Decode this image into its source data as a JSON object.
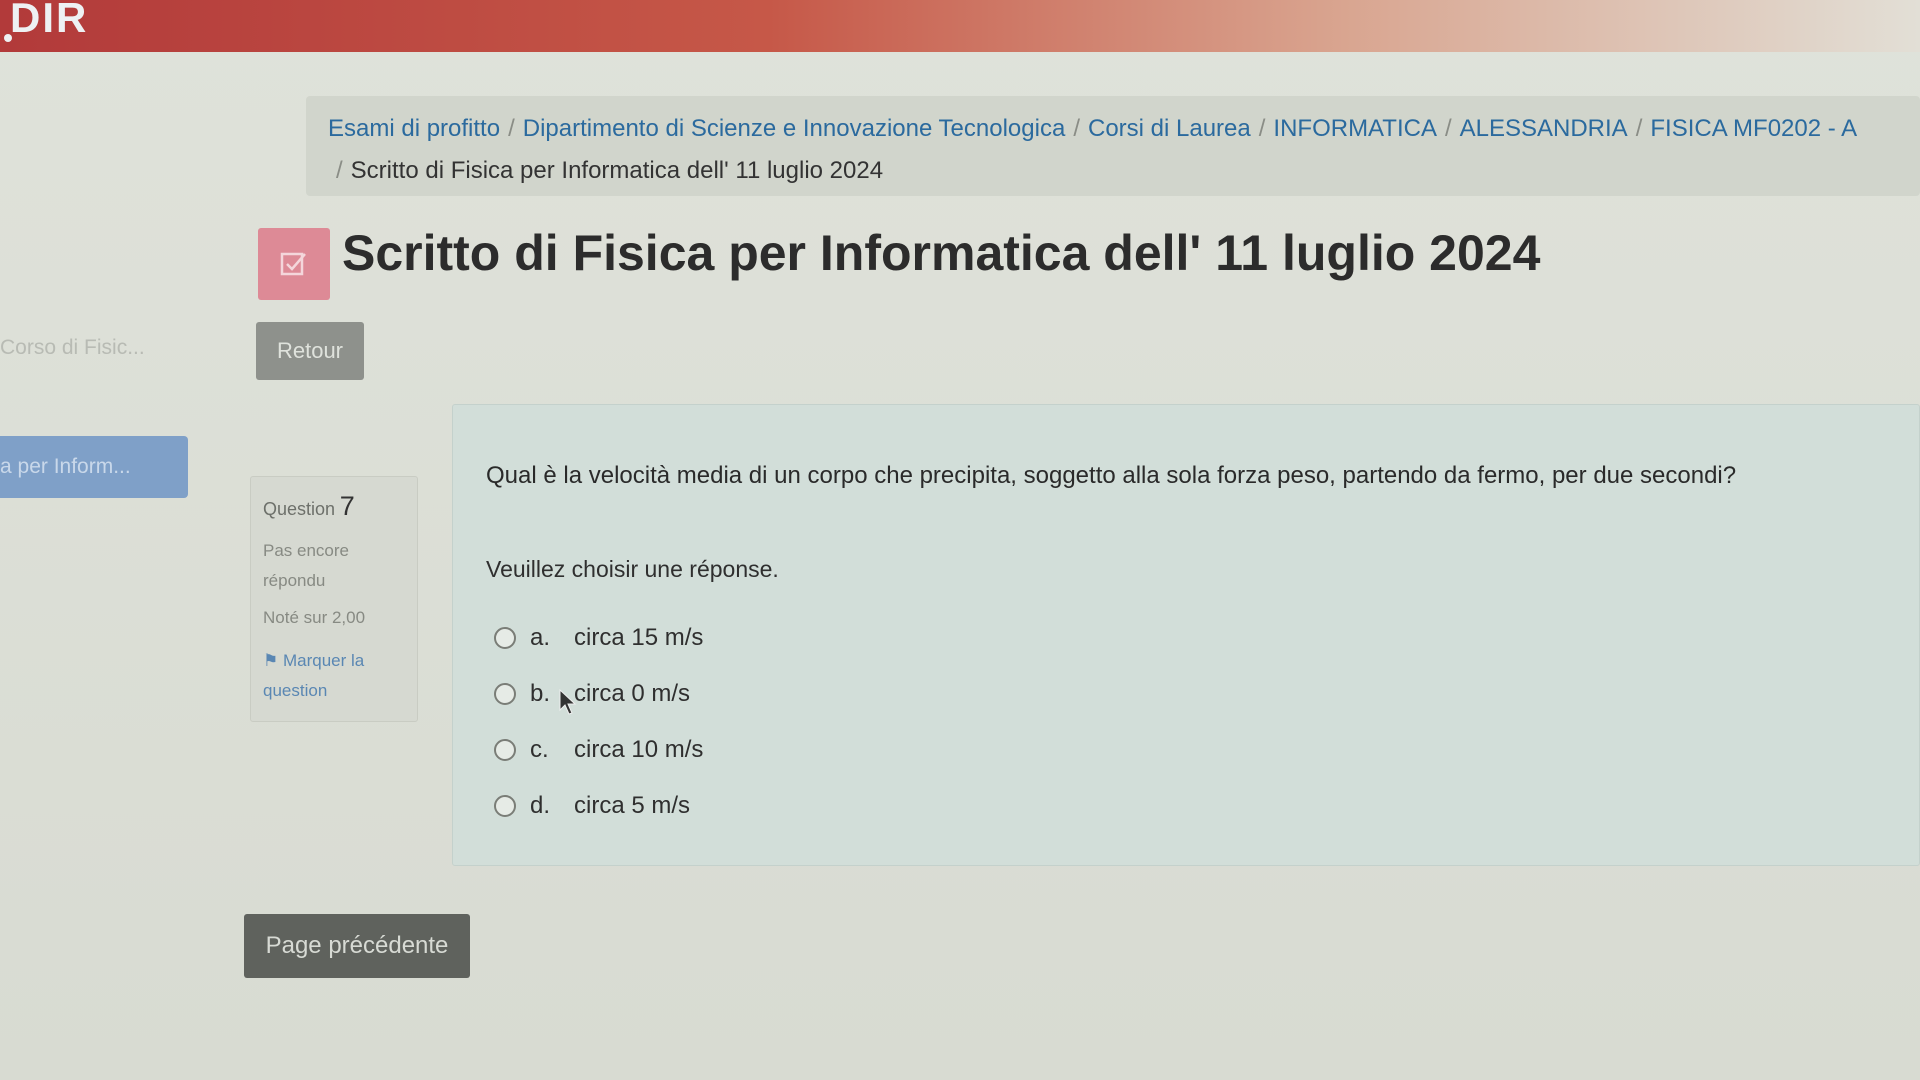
{
  "header": {
    "logo_text": "DIR"
  },
  "sidebar": {
    "course_label": "Corso di Fisic...",
    "active_item": "a per Inform..."
  },
  "breadcrumb": {
    "items": [
      "Esami di profitto",
      "Dipartimento di Scienze e Innovazione Tecnologica",
      "Corsi di Laurea",
      "INFORMATICA",
      "ALESSANDRIA",
      "FISICA MF0202 - A"
    ],
    "separator": "/",
    "current": "Scritto di Fisica per Informatica dell' 11 luglio 2024"
  },
  "page": {
    "title": "Scritto di Fisica per Informatica dell' 11 luglio 2024",
    "title_icon": "quiz-checkbox-icon",
    "retour_label": "Retour"
  },
  "question_info": {
    "label": "Question",
    "number": "7",
    "state": "Pas encore répondu",
    "grade": "Noté sur 2,00",
    "flag_label": "Marquer la question",
    "flag_icon": "flag-icon"
  },
  "question": {
    "text": "Qual è la velocità media di un corpo che precipita, soggetto alla sola forza peso, partendo da fermo, per due secondi?",
    "prompt": "Veuillez choisir une réponse.",
    "answers": [
      {
        "letter": "a.",
        "text": "circa 15 m/s"
      },
      {
        "letter": "b.",
        "text": "circa 0 m/s"
      },
      {
        "letter": "c.",
        "text": "circa 10 m/s"
      },
      {
        "letter": "d.",
        "text": "circa 5 m/s"
      }
    ]
  },
  "navigation": {
    "previous_label": "Page précédente"
  },
  "colors": {
    "header_red": "#b23a3a",
    "link_blue": "#2b6a9e",
    "icon_pink": "#dd8a96",
    "question_bg": "#d2ded9"
  }
}
